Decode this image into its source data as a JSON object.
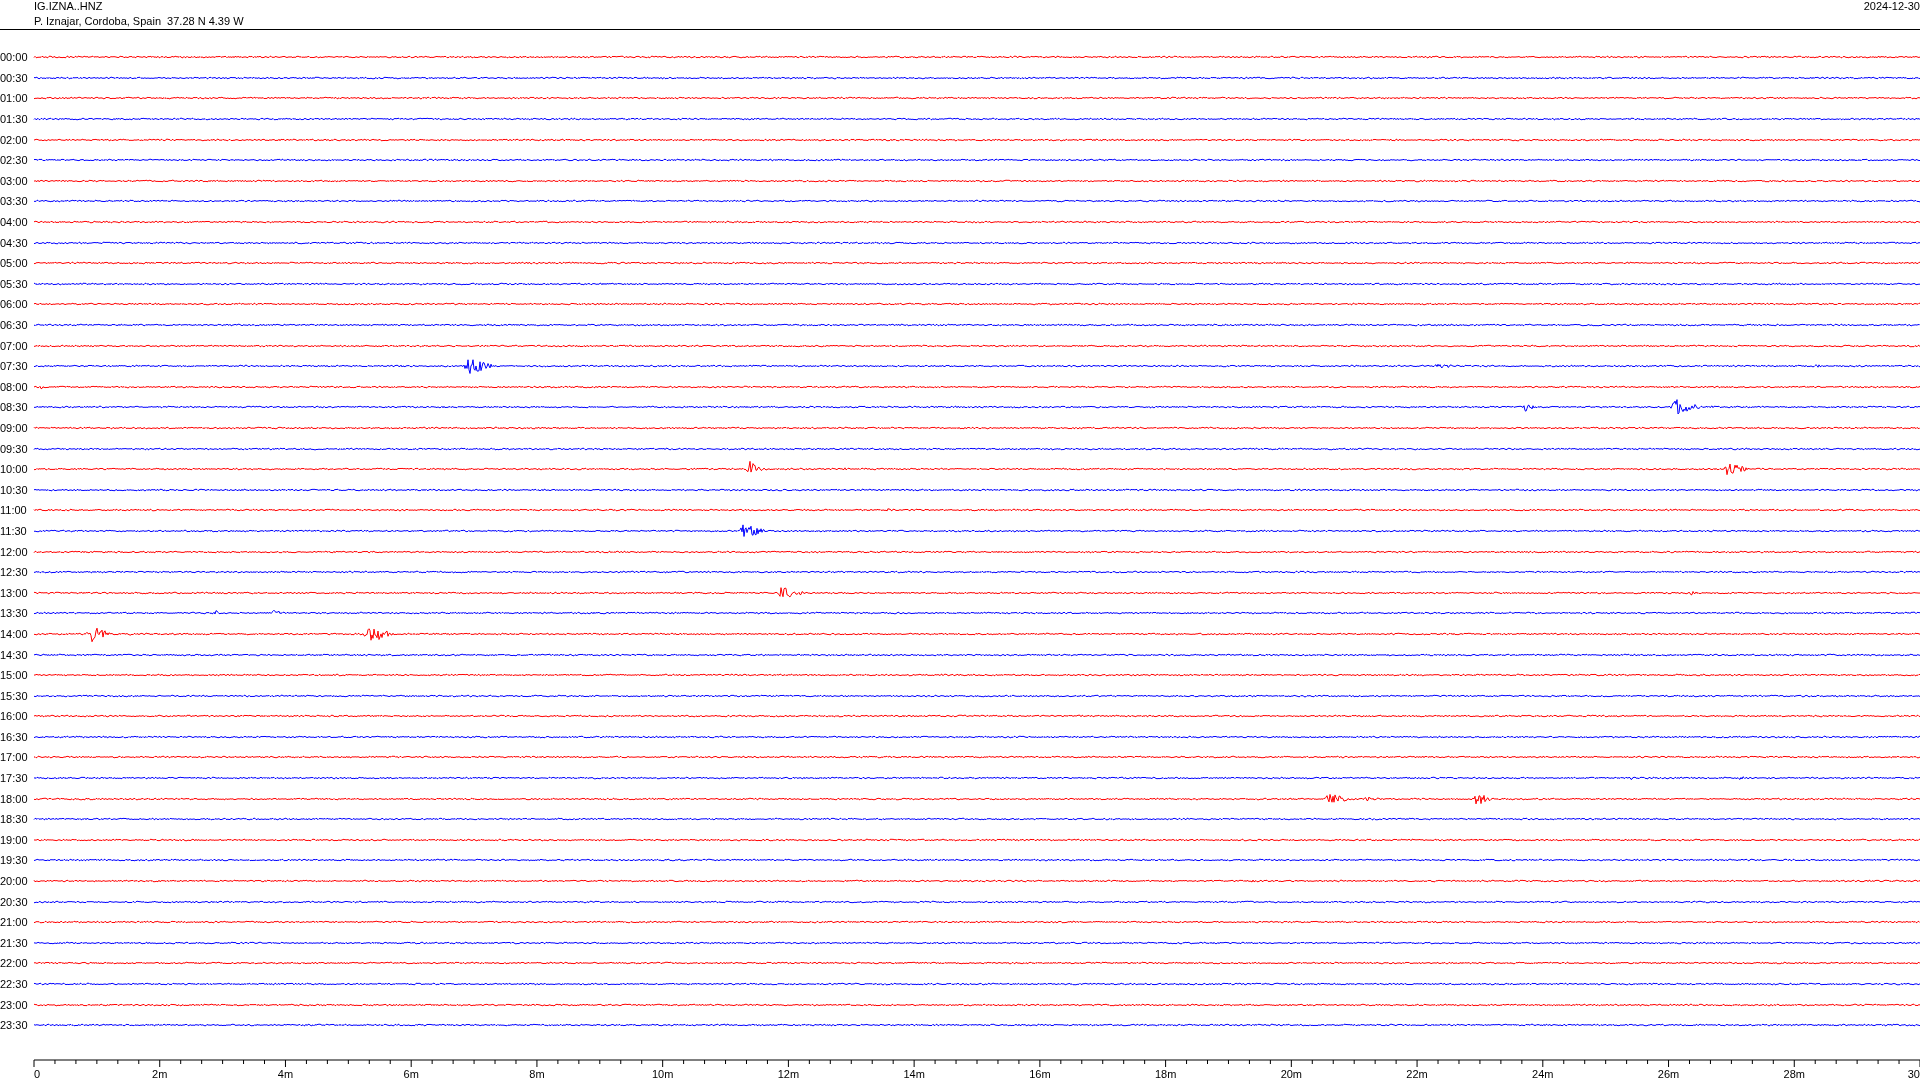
{
  "header": {
    "station": "IG.IZNA..HNZ",
    "location": "P. Iznajar, Cordoba, Spain  37.28 N 4.39 W",
    "date": "2024-12-30"
  },
  "traces": [
    {
      "time": "00:00",
      "color": "#ff0000"
    },
    {
      "time": "00:30",
      "color": "#0000ff"
    },
    {
      "time": "01:00",
      "color": "#ff0000"
    },
    {
      "time": "01:30",
      "color": "#0000ff"
    },
    {
      "time": "02:00",
      "color": "#ff0000"
    },
    {
      "time": "02:30",
      "color": "#0000ff"
    },
    {
      "time": "03:00",
      "color": "#ff0000"
    },
    {
      "time": "03:30",
      "color": "#0000ff"
    },
    {
      "time": "04:00",
      "color": "#ff0000"
    },
    {
      "time": "04:30",
      "color": "#0000ff"
    },
    {
      "time": "05:00",
      "color": "#ff0000"
    },
    {
      "time": "05:30",
      "color": "#0000ff"
    },
    {
      "time": "06:00",
      "color": "#ff0000"
    },
    {
      "time": "06:30",
      "color": "#0000ff"
    },
    {
      "time": "07:00",
      "color": "#ff0000"
    },
    {
      "time": "07:30",
      "color": "#0000ff"
    },
    {
      "time": "08:00",
      "color": "#ff0000"
    },
    {
      "time": "08:30",
      "color": "#0000ff"
    },
    {
      "time": "09:00",
      "color": "#ff0000"
    },
    {
      "time": "09:30",
      "color": "#0000ff"
    },
    {
      "time": "10:00",
      "color": "#ff0000"
    },
    {
      "time": "10:30",
      "color": "#0000ff"
    },
    {
      "time": "11:00",
      "color": "#ff0000"
    },
    {
      "time": "11:30",
      "color": "#0000ff"
    },
    {
      "time": "12:00",
      "color": "#ff0000"
    },
    {
      "time": "12:30",
      "color": "#0000ff"
    },
    {
      "time": "13:00",
      "color": "#ff0000"
    },
    {
      "time": "13:30",
      "color": "#0000ff"
    },
    {
      "time": "14:00",
      "color": "#ff0000"
    },
    {
      "time": "14:30",
      "color": "#0000ff"
    },
    {
      "time": "15:00",
      "color": "#ff0000"
    },
    {
      "time": "15:30",
      "color": "#0000ff"
    },
    {
      "time": "16:00",
      "color": "#ff0000"
    },
    {
      "time": "16:30",
      "color": "#0000ff"
    },
    {
      "time": "17:00",
      "color": "#ff0000"
    },
    {
      "time": "17:30",
      "color": "#0000ff"
    },
    {
      "time": "18:00",
      "color": "#ff0000"
    },
    {
      "time": "18:30",
      "color": "#0000ff"
    },
    {
      "time": "19:00",
      "color": "#ff0000"
    },
    {
      "time": "19:30",
      "color": "#0000ff"
    },
    {
      "time": "20:00",
      "color": "#ff0000"
    },
    {
      "time": "20:30",
      "color": "#0000ff"
    },
    {
      "time": "21:00",
      "color": "#ff0000"
    },
    {
      "time": "21:30",
      "color": "#0000ff"
    },
    {
      "time": "22:00",
      "color": "#ff0000"
    },
    {
      "time": "22:30",
      "color": "#0000ff"
    },
    {
      "time": "23:00",
      "color": "#ff0000"
    },
    {
      "time": "23:30",
      "color": "#0000ff"
    }
  ],
  "time_axis": {
    "labels": [
      "0",
      "2m",
      "4m",
      "6m",
      "8m",
      "10m",
      "12m",
      "14m",
      "16m",
      "18m",
      "20m",
      "22m",
      "24m",
      "26m",
      "28m",
      "30"
    ]
  }
}
